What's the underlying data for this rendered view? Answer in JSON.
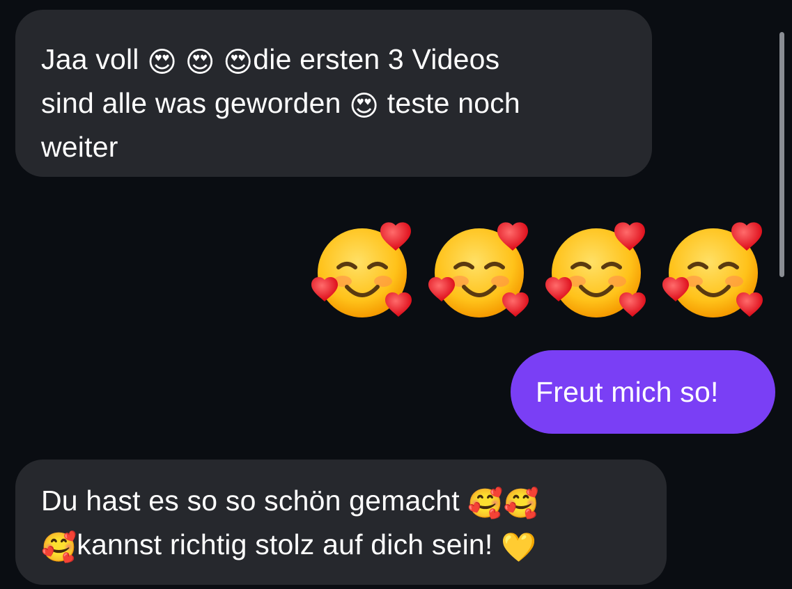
{
  "messages": [
    {
      "direction": "incoming",
      "lines": [
        {
          "before": "Jaa voll ",
          "emojis": [
            "😍",
            "😍",
            "😍"
          ],
          "after": "die ersten 3 Videos"
        },
        {
          "before": "sind alle was geworden ",
          "emojis": [
            "😍"
          ],
          "after": " teste noch"
        },
        {
          "before": "weiter",
          "emojis": [],
          "after": ""
        }
      ]
    },
    {
      "direction": "outgoing",
      "emoji_only": [
        "🥰",
        "🥰",
        "🥰",
        "🥰"
      ]
    },
    {
      "direction": "outgoing",
      "text": "Freut mich so!"
    },
    {
      "direction": "incoming",
      "lines": [
        {
          "before": "Du hast es so so schön gemacht ",
          "emojis": [
            "🥰",
            "🥰"
          ],
          "after": ""
        },
        {
          "before": "",
          "emojis": [
            "🥰"
          ],
          "after": "kannst richtig stolz auf dich sein! ",
          "trail_emoji": "💛"
        }
      ]
    }
  ],
  "colors": {
    "background": "#0a0d12",
    "incoming_bubble": "#26282d",
    "outgoing_bubble": "#7a3ff5",
    "text": "#ffffff",
    "scrollbar": "#8a8d93"
  }
}
